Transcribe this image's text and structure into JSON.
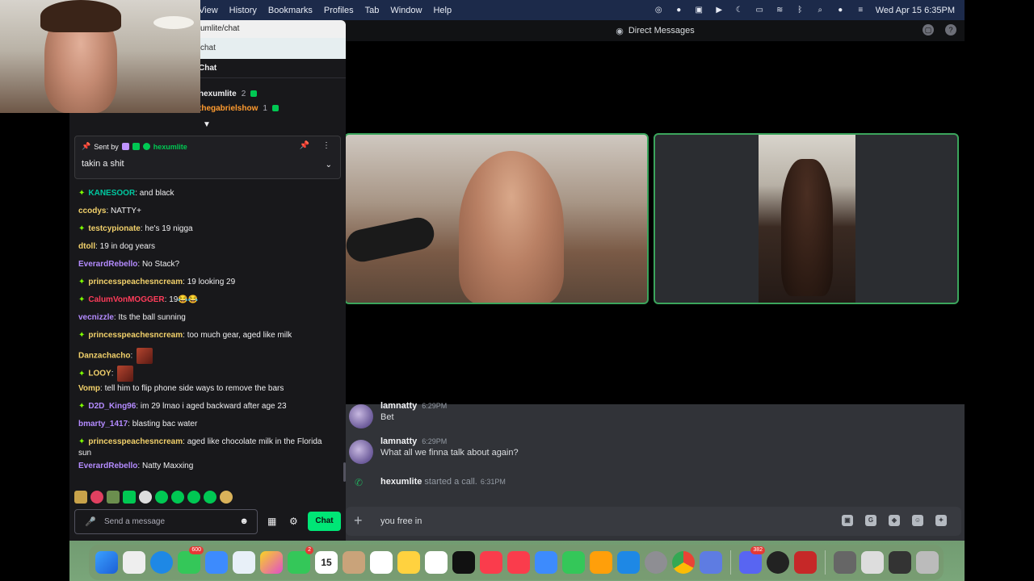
{
  "menubar": {
    "menus": [
      "View",
      "History",
      "Bookmarks",
      "Profiles",
      "Tab",
      "Window",
      "Help"
    ],
    "clock": "Wed Apr 15  6:35PM"
  },
  "discord": {
    "title": "Direct Messages",
    "messages": [
      {
        "author": "lamnatty",
        "time": "6:29PM",
        "text": "Bet"
      },
      {
        "author": "lamnatty",
        "time": "6:29PM",
        "text": "What all we finna talk about again?"
      }
    ],
    "call_event": {
      "user": "hexumlite",
      "action": "started a call.",
      "time": "6:31PM"
    },
    "composer_value": "you free in"
  },
  "chat": {
    "url": "umlite/chat",
    "search": "chat",
    "header": "Chat",
    "leaderboard": [
      {
        "name": "hexumlite",
        "count": "2"
      },
      {
        "name": "thegabrielshow",
        "count": "1"
      }
    ],
    "pinned": {
      "sent_by_label": "Sent by",
      "user": "hexumlite",
      "text": "takin a shit"
    },
    "lines": [
      {
        "user": "KANESOOR",
        "color": "#00c8a0",
        "star": true,
        "text": "and black"
      },
      {
        "user": "ccodys",
        "color": "#f2d16b",
        "star": false,
        "text": "NATTY+"
      },
      {
        "user": "testcypionate",
        "color": "#f2d16b",
        "star": true,
        "text": "he's 19 nigga"
      },
      {
        "user": "dtoll",
        "color": "#f2d16b",
        "star": false,
        "text": "19 in dog years"
      },
      {
        "user": "EverardRebello",
        "color": "#b48bff",
        "star": false,
        "text": "No Stack?"
      },
      {
        "user": "princesspeachesncream",
        "color": "#f2d16b",
        "star": true,
        "text": "19 looking 29"
      },
      {
        "user": "CalumVonMOGGER",
        "color": "#ff3c5a",
        "star": true,
        "text": "19😂😂"
      },
      {
        "user": "vecnizzle",
        "color": "#b48bff",
        "star": false,
        "text": "Its the ball sunning"
      },
      {
        "user": "princesspeachesncream",
        "color": "#f2d16b",
        "star": true,
        "text": "too much gear, aged like milk"
      },
      {
        "user": "Danzachacho",
        "color": "#f2d16b",
        "star": false,
        "text": ""
      },
      {
        "user": "LOOY",
        "color": "#f2d16b",
        "star": true,
        "text": ""
      },
      {
        "user": "Vomp",
        "color": "#f2d16b",
        "star": false,
        "text": "tell him to flip phone side ways to remove the bars"
      },
      {
        "user": "D2D_King96",
        "color": "#b48bff",
        "star": true,
        "text": "im 29 lmao i aged backward after age 23"
      },
      {
        "user": "bmarty_1417",
        "color": "#b48bff",
        "star": false,
        "text": "blasting bac water"
      },
      {
        "user": "princesspeachesncream",
        "color": "#f2d16b",
        "star": true,
        "text": "aged like chocolate milk in the Florida sun"
      },
      {
        "user": "EverardRebello",
        "color": "#b48bff",
        "star": false,
        "text": "Natty Maxxing"
      }
    ],
    "input_placeholder": "Send a message",
    "send_label": "Chat"
  },
  "dock": {
    "badges": {
      "messages": "600",
      "facetime": "2",
      "discord": "382"
    },
    "calendar_day": "15"
  }
}
